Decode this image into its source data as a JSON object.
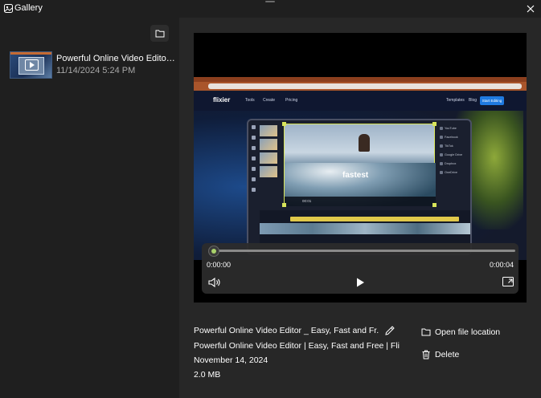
{
  "window": {
    "title": "Gallery"
  },
  "sidebar": {
    "items": [
      {
        "title": "Powerful Online Video Editor _ Easy, Fast and Free",
        "date": "11/14/2024 5:24 PM"
      }
    ]
  },
  "video_frame": {
    "logo": "flixier",
    "nav": [
      "Tools",
      "Create",
      "Pricing",
      "Templates",
      "Blog"
    ],
    "cta": "Start Editing",
    "overlay_word": "fastest",
    "preview_time": "00:01",
    "props": [
      "YouTube",
      "Facebook",
      "TikTok",
      "Google Drive",
      "Dropbox",
      "OneDrive"
    ]
  },
  "player": {
    "current_time": "0:00:00",
    "total_time": "0:00:04",
    "progress": 0.0
  },
  "details": {
    "title": "Powerful Online Video Editor _ Easy, Fast and Fr...",
    "description": "Powerful Online Video Editor | Easy, Fast and Free | Fli...",
    "date": "November 14, 2024",
    "size": "2.0 MB"
  },
  "actions": {
    "open_location": "Open file location",
    "delete": "Delete"
  },
  "colors": {
    "accent": "#a9d26b",
    "background": "#1f1f1f",
    "panel": "#272727"
  }
}
